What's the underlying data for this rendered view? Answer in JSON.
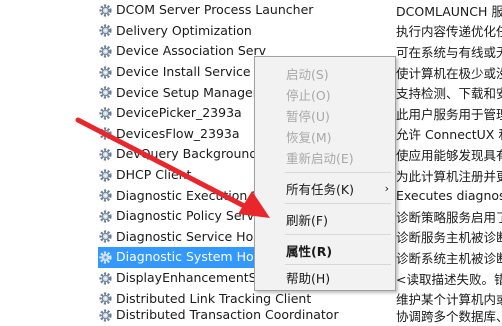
{
  "services": [
    {
      "name": "DCOM Server Process Launcher",
      "desc": "DCOMLAUNCH 服"
    },
    {
      "name": "Delivery Optimization",
      "desc": "执行内容传递优化任"
    },
    {
      "name": "Device Association Serv",
      "desc": "可在系统与有线或无线"
    },
    {
      "name": "Device Install Service",
      "desc": "使计算机在极少或没"
    },
    {
      "name": "Device Setup Manager",
      "desc": "支持检测、下载和安"
    },
    {
      "name": "DevicePicker_2393a",
      "desc": "此用户服务用于管理"
    },
    {
      "name": "DevicesFlow_2393a",
      "desc": "允许 ConnectUX 和"
    },
    {
      "name": "DevQuery Background",
      "desc": "使应用能够发现具有"
    },
    {
      "name": "DHCP Client",
      "desc": "为此计算机注册并更"
    },
    {
      "name": "Diagnostic Execution S",
      "desc": "Executes diagnosti"
    },
    {
      "name": "Diagnostic Policy Servic",
      "desc": "诊断策略服务启用了"
    },
    {
      "name": "Diagnostic Service Host",
      "desc": "诊断服务主机被诊断"
    },
    {
      "name": "Diagnostic System Host",
      "desc": "诊断系统主机被诊断"
    },
    {
      "name": "DisplayEnhancementService",
      "desc": "<读取描述失败。错"
    },
    {
      "name": "Distributed Link Tracking Client",
      "desc": "维护某个计算机内或"
    },
    {
      "name": "Distributed Transaction Coordinator",
      "desc": "协调跨多个数据库、"
    }
  ],
  "selected_index": 12,
  "context_menu": {
    "start": "启动(S)",
    "stop": "停止(O)",
    "pause": "暂停(U)",
    "resume": "恢复(M)",
    "restart": "重新启动(E)",
    "all_tasks": "所有任务(K)",
    "all_tasks_arrow": "›",
    "refresh": "刷新(F)",
    "properties": "属性(R)",
    "help": "帮助(H)"
  },
  "colors": {
    "selection": "#3399ff",
    "arrow": "#e8262b"
  }
}
